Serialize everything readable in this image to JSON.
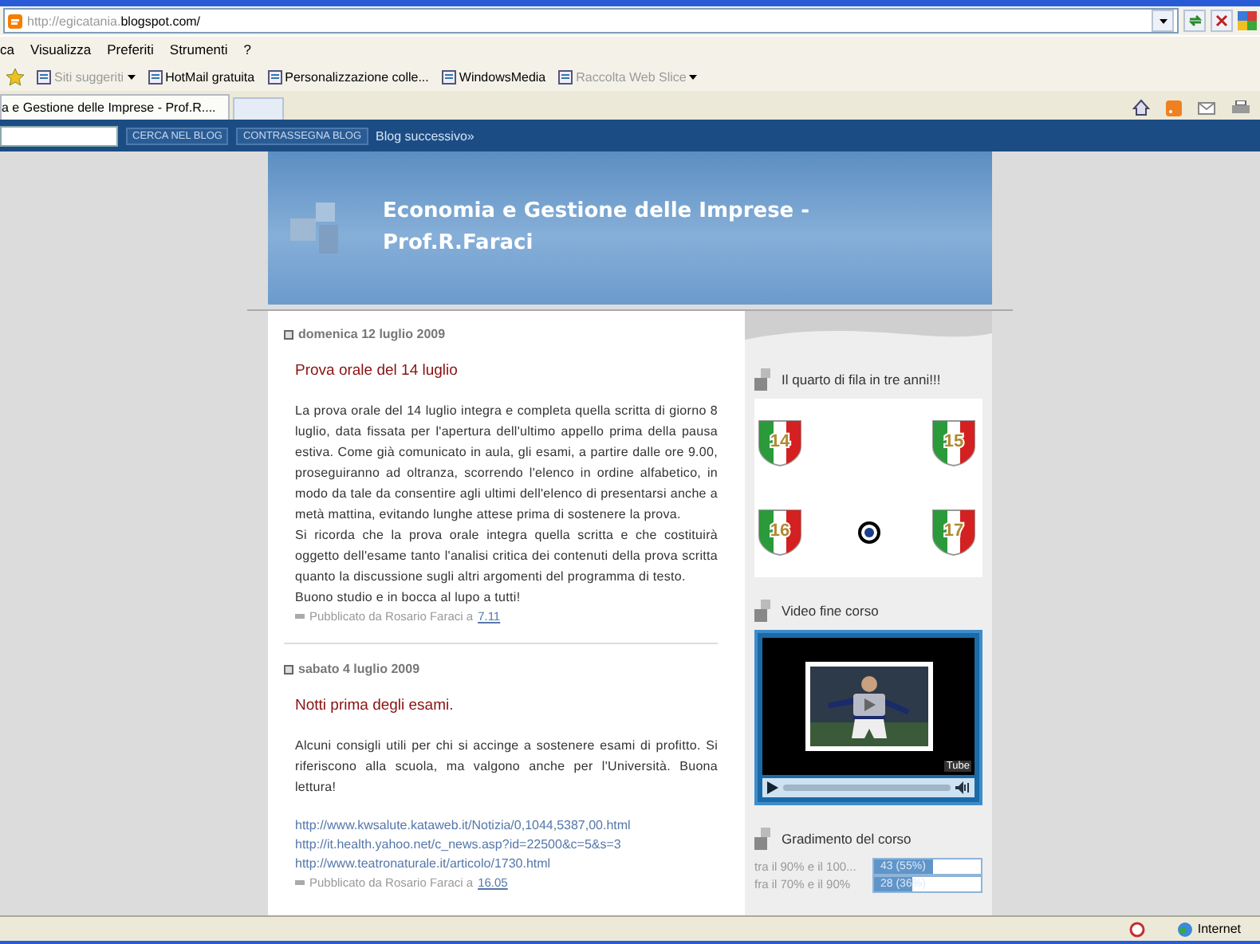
{
  "browser": {
    "address_prefix": "http://egicatania.",
    "address_domain": "blogspot.com/",
    "menu": [
      "ca",
      "Visualizza",
      "Preferiti",
      "Strumenti",
      "?"
    ],
    "favorites": [
      {
        "label": "Siti suggeriti",
        "disabled": true,
        "dropdown": true
      },
      {
        "label": "HotMail gratuita",
        "disabled": false,
        "dropdown": false
      },
      {
        "label": "Personalizzazione colle...",
        "disabled": false,
        "dropdown": false
      },
      {
        "label": "WindowsMedia",
        "disabled": false,
        "dropdown": false
      },
      {
        "label": "Raccolta Web Slice",
        "disabled": true,
        "dropdown": true
      }
    ],
    "tabs": [
      {
        "label": "a e Gestione delle Imprese - Prof.R....",
        "selected": true
      }
    ],
    "status": "Internet"
  },
  "navbar": {
    "search_button": "CERCA NEL BLOG",
    "flag_button": "CONTRASSEGNA BLOG",
    "next_link": "Blog successivo»"
  },
  "blog": {
    "title": "Economia e Gestione delle Imprese - Prof.R.Faraci",
    "posts": [
      {
        "date": "domenica 12 luglio 2009",
        "title": "Prova orale del 14 luglio",
        "paragraphs": [
          "La prova orale del 14 luglio integra e completa quella scritta di giorno 8 luglio, data fissata per l'apertura dell'ultimo appello prima della pausa estiva. Come già comunicato in aula, gli esami, a partire dalle ore 9.00, proseguiranno ad oltranza, scorrendo l'elenco in ordine alfabetico, in modo da tale da consentire agli ultimi dell'elenco di presentarsi anche a metà mattina, evitando lunghe attese prima di sostenere la prova.",
          "Si ricorda che la prova orale integra quella scritta e che costituirà oggetto dell'esame tanto l'analisi critica dei contenuti della prova scritta quanto la discussione sugli altri argomenti del programma di testo.",
          "Buono studio e in bocca al lupo a tutti!"
        ],
        "byline": "Pubblicato da Rosario Faraci a",
        "time": "7.11"
      },
      {
        "date": "sabato 4 luglio 2009",
        "title": "Notti prima degli esami.",
        "paragraphs": [
          "Alcuni consigli utili per chi si accinge a sostenere esami di profitto. Si riferiscono alla scuola, ma valgono anche per l'Università. Buona lettura!"
        ],
        "links": [
          "http://www.kwsalute.kataweb.it/Notizia/0,1044,5387,00.html",
          "http://it.health.yahoo.net/c_news.asp?id=22500&c=5&s=3",
          "http://www.teatronaturale.it/articolo/1730.html"
        ],
        "byline": "Pubblicato da Rosario Faraci a",
        "time": "16.05"
      }
    ],
    "sidebar": [
      {
        "kind": "shields",
        "title": "Il quarto di fila in tre anni!!!",
        "shields": [
          "14",
          "15",
          "16",
          "17"
        ]
      },
      {
        "kind": "video",
        "title": "Video fine corso",
        "logo": "Tube"
      },
      {
        "kind": "poll",
        "title": "Gradimento del corso",
        "options": [
          {
            "label": "tra il 90% e il 100...",
            "result": "43 (55%)",
            "level": 0.55
          },
          {
            "label": "fra il 70% e il 90%",
            "result": "28 (36%)",
            "level": 0.36
          }
        ]
      }
    ]
  }
}
